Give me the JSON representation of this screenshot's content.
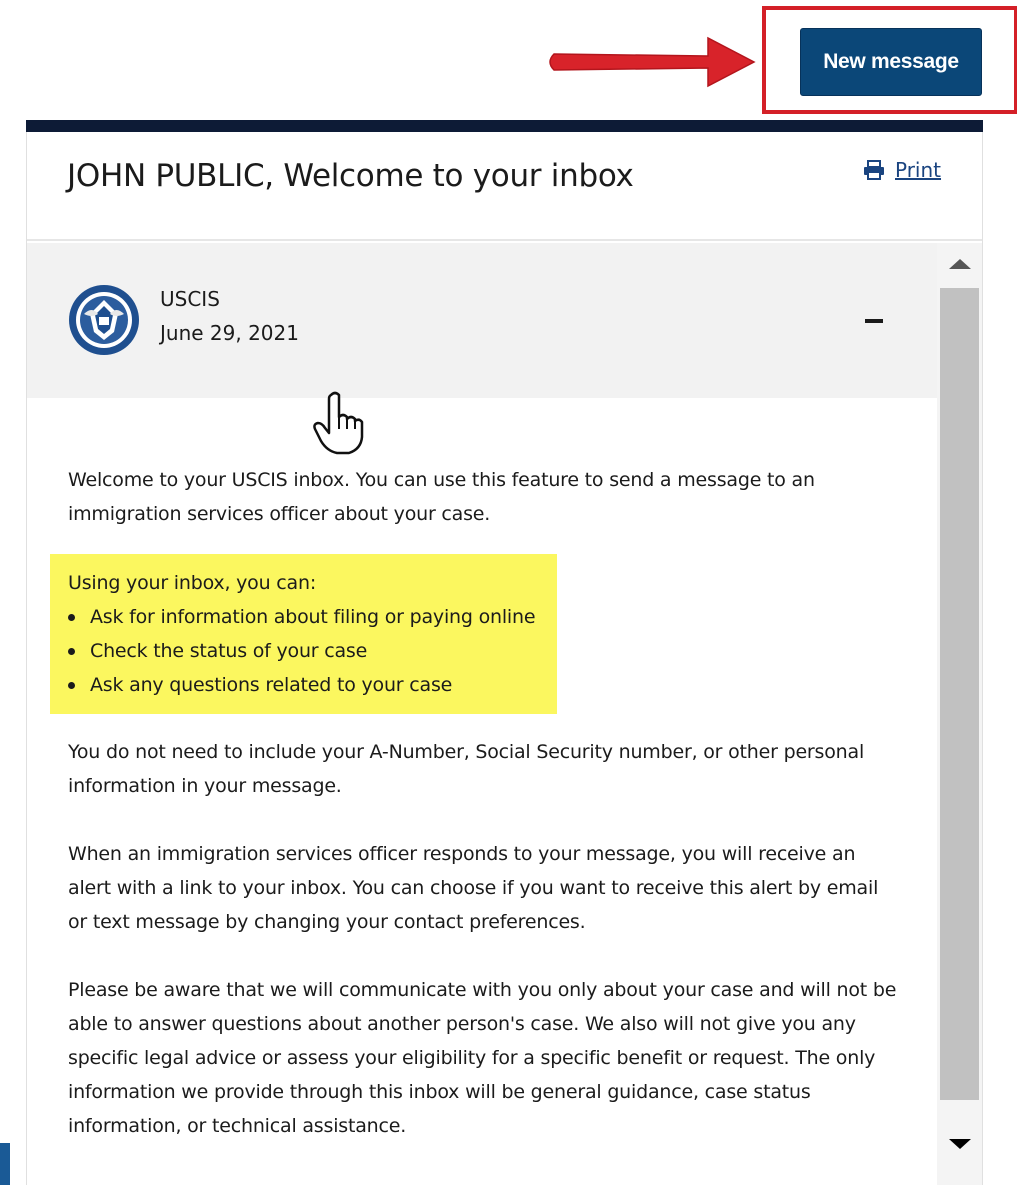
{
  "toolbar": {
    "new_message_label": "New message"
  },
  "inbox": {
    "title": "JOHN PUBLIC, Welcome to your inbox",
    "print_label": "Print"
  },
  "message": {
    "sender": "USCIS",
    "date": "June 29, 2021",
    "intro": "Welcome to your USCIS inbox. You can use this feature to send a message to an immigration services officer about your case.",
    "callout": {
      "heading": "Using your inbox, you can:",
      "items": [
        "Ask for information about filing or paying online",
        "Check the status of your case",
        "Ask any questions related to your case"
      ]
    },
    "paragraphs": [
      "You do not need to include your A-Number, Social Security number, or other personal information in your message.",
      "When an immigration services officer responds to your message, you will receive an alert with a link to your inbox. You can choose if you want to receive this alert by email or text message by changing your contact preferences.",
      "Please be aware that we will communicate with you only about your case and will not be able to answer questions about another person's case. We also will not give you any specific legal advice or assess your eligibility for a specific benefit or request. The only information we provide through this inbox will be general guidance, case status information, or technical assistance."
    ]
  },
  "icons": {
    "print": "printer-icon",
    "seal": "dhs-seal-icon",
    "collapse": "minus-icon",
    "annotation_arrow": "red-arrow-icon",
    "cursor": "hand-pointer-icon"
  },
  "colors": {
    "primary_button": "#0b4778",
    "annotation_red": "#d42027",
    "panel_topbar": "#0d1b36",
    "highlight_yellow": "#fbf75f",
    "link": "#1a4480"
  }
}
